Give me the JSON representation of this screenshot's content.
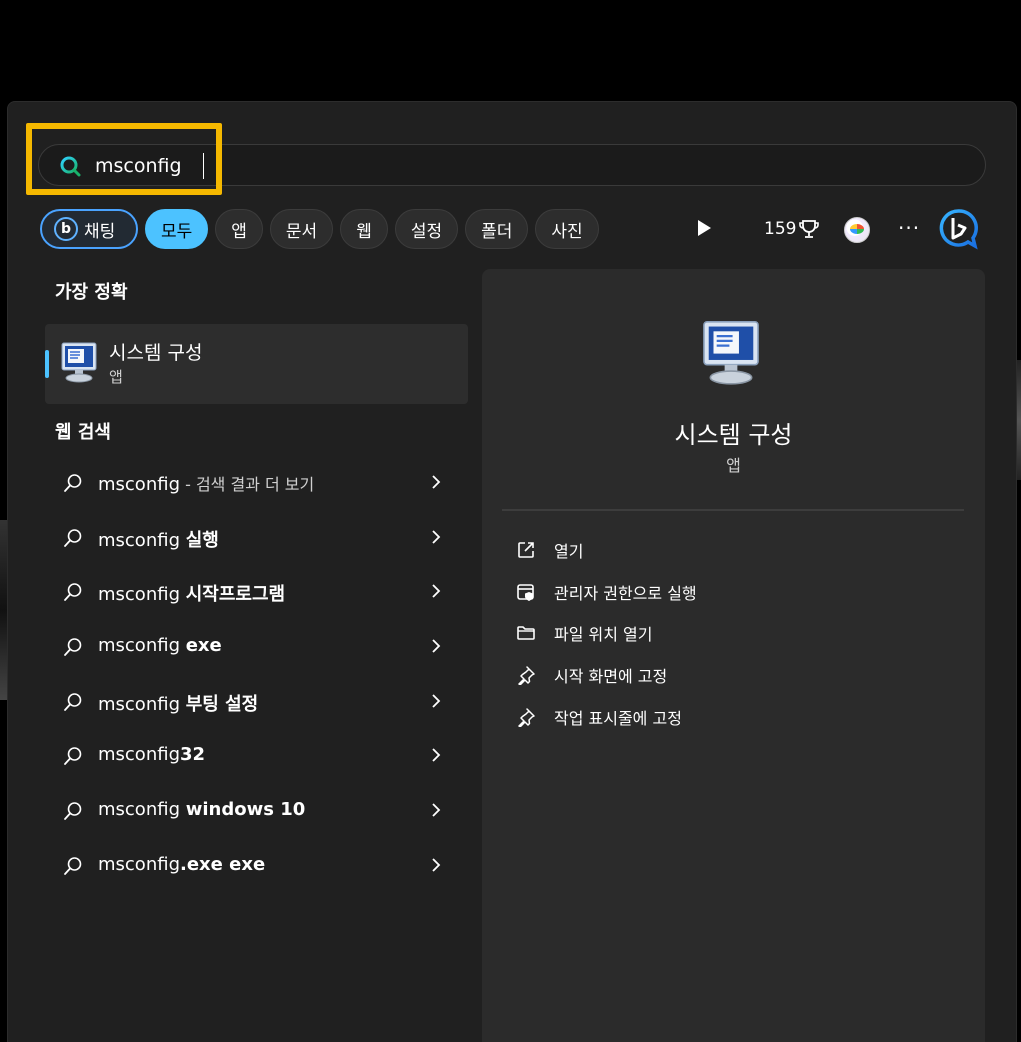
{
  "search": {
    "query": "msconfig"
  },
  "filters": [
    "채팅",
    "모두",
    "앱",
    "문서",
    "웹",
    "설정",
    "폴더",
    "사진"
  ],
  "toolbar": {
    "points": "159"
  },
  "best_match": {
    "title": "가장 정확",
    "name": "시스템 구성",
    "type": "앱"
  },
  "web_search": {
    "title": "웹 검색",
    "items": [
      {
        "prefix": "msconfig",
        "bold": "",
        "dim": " - 검색 결과 더 보기"
      },
      {
        "prefix": "msconfig ",
        "bold": "실행",
        "dim": ""
      },
      {
        "prefix": "msconfig ",
        "bold": "시작프로그램",
        "dim": ""
      },
      {
        "prefix": "msconfig ",
        "bold": "exe",
        "dim": ""
      },
      {
        "prefix": "msconfig ",
        "bold": "부팅 설정",
        "dim": ""
      },
      {
        "prefix": "msconfig",
        "bold": "32",
        "dim": ""
      },
      {
        "prefix": "msconfig ",
        "bold": "windows 10",
        "dim": ""
      },
      {
        "prefix": "msconfig",
        "bold": ".exe exe",
        "dim": ""
      }
    ]
  },
  "detail": {
    "name": "시스템 구성",
    "type": "앱",
    "actions": [
      {
        "label": "열기",
        "icon": "open-external-icon"
      },
      {
        "label": "관리자 권한으로 실행",
        "icon": "shield-run-icon"
      },
      {
        "label": "파일 위치 열기",
        "icon": "folder-icon"
      },
      {
        "label": "시작 화면에 고정",
        "icon": "pin-icon"
      },
      {
        "label": "작업 표시줄에 고정",
        "icon": "pin-icon"
      }
    ]
  },
  "colors": {
    "accent": "#4cc2ff",
    "highlight": "#f5b800",
    "panel": "#202020"
  }
}
